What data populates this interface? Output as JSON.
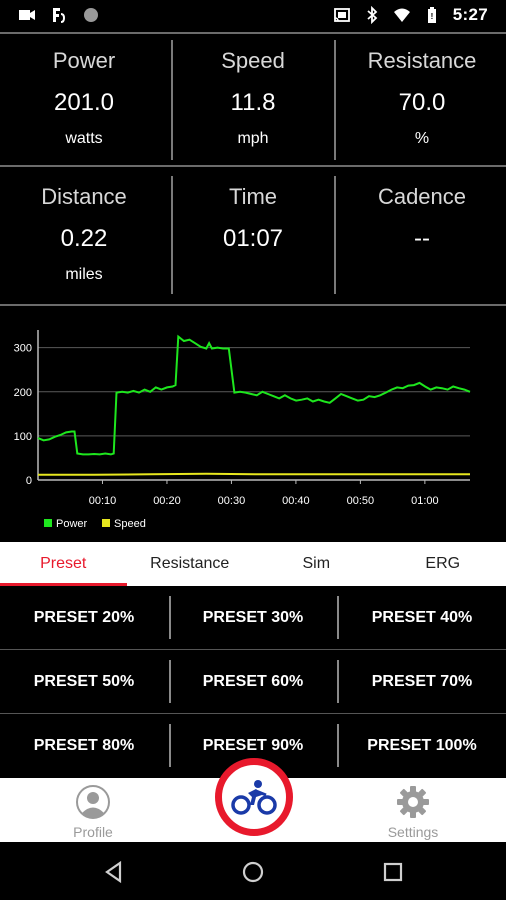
{
  "status_bar": {
    "time": "5:27",
    "left_icons": [
      "video-icon",
      "fire-tv-icon",
      "circle-icon"
    ],
    "right_icons": [
      "cast-icon",
      "bluetooth-icon",
      "wifi-icon",
      "battery-icon"
    ]
  },
  "metrics": [
    {
      "label": "Power",
      "value": "201.0",
      "unit": "watts"
    },
    {
      "label": "Speed",
      "value": "11.8",
      "unit": "mph"
    },
    {
      "label": "Resistance",
      "value": "70.0",
      "unit": "%"
    },
    {
      "label": "Distance",
      "value": "0.22",
      "unit": "miles"
    },
    {
      "label": "Time",
      "value": "01:07",
      "unit": ""
    },
    {
      "label": "Cadence",
      "value": "--",
      "unit": ""
    }
  ],
  "chart_data": {
    "type": "line",
    "x_tick_labels": [
      "00:10",
      "00:20",
      "00:30",
      "00:40",
      "00:50",
      "01:00"
    ],
    "y_tick_labels": [
      "0",
      "100",
      "200",
      "300"
    ],
    "ylim": [
      0,
      340
    ],
    "xlim": [
      0,
      68
    ],
    "grid": true,
    "legend_position": "bottom-left",
    "series": [
      {
        "name": "Power",
        "color": "#1ee61e",
        "points": [
          [
            0,
            95
          ],
          [
            1,
            90
          ],
          [
            2,
            92
          ],
          [
            3,
            98
          ],
          [
            4,
            102
          ],
          [
            5,
            108
          ],
          [
            6,
            110
          ],
          [
            6.5,
            110
          ],
          [
            7,
            60
          ],
          [
            8,
            58
          ],
          [
            9,
            58
          ],
          [
            10,
            59
          ],
          [
            11,
            58
          ],
          [
            12,
            60
          ],
          [
            13,
            58
          ],
          [
            13.5,
            60
          ],
          [
            14,
            198
          ],
          [
            15,
            200
          ],
          [
            16,
            198
          ],
          [
            17,
            202
          ],
          [
            18,
            198
          ],
          [
            19,
            205
          ],
          [
            20,
            200
          ],
          [
            21,
            210
          ],
          [
            22,
            205
          ],
          [
            23,
            210
          ],
          [
            24,
            212
          ],
          [
            24.5,
            215
          ],
          [
            25,
            325
          ],
          [
            26,
            315
          ],
          [
            27,
            318
          ],
          [
            28,
            310
          ],
          [
            29,
            302
          ],
          [
            30,
            298
          ],
          [
            30.5,
            310
          ],
          [
            31,
            298
          ],
          [
            32,
            300
          ],
          [
            33,
            298
          ],
          [
            34,
            298
          ],
          [
            35,
            198
          ],
          [
            36,
            200
          ],
          [
            37,
            198
          ],
          [
            38,
            195
          ],
          [
            39,
            192
          ],
          [
            40,
            200
          ],
          [
            41,
            195
          ],
          [
            42,
            190
          ],
          [
            43,
            185
          ],
          [
            44,
            192
          ],
          [
            45,
            185
          ],
          [
            46,
            180
          ],
          [
            47,
            182
          ],
          [
            48,
            185
          ],
          [
            49,
            178
          ],
          [
            50,
            182
          ],
          [
            51,
            178
          ],
          [
            52,
            175
          ],
          [
            53,
            185
          ],
          [
            54,
            195
          ],
          [
            55,
            190
          ],
          [
            56,
            185
          ],
          [
            57,
            180
          ],
          [
            58,
            182
          ],
          [
            59,
            190
          ],
          [
            60,
            188
          ],
          [
            61,
            192
          ],
          [
            62,
            198
          ],
          [
            63,
            205
          ],
          [
            64,
            210
          ],
          [
            65,
            208
          ],
          [
            66,
            214
          ],
          [
            67,
            215
          ],
          [
            68,
            220
          ],
          [
            69,
            212
          ],
          [
            70,
            205
          ],
          [
            71,
            210
          ],
          [
            72,
            208
          ],
          [
            73,
            205
          ],
          [
            74,
            212
          ],
          [
            75,
            208
          ],
          [
            76,
            205
          ],
          [
            77,
            200
          ]
        ]
      },
      {
        "name": "Speed",
        "color": "#e6e61e",
        "points": [
          [
            0,
            12
          ],
          [
            10,
            12
          ],
          [
            20,
            13
          ],
          [
            30,
            14
          ],
          [
            40,
            13
          ],
          [
            50,
            13
          ],
          [
            60,
            13
          ],
          [
            70,
            13
          ],
          [
            77,
            13
          ]
        ]
      }
    ]
  },
  "tabs": [
    {
      "label": "Preset",
      "active": true
    },
    {
      "label": "Resistance",
      "active": false
    },
    {
      "label": "Sim",
      "active": false
    },
    {
      "label": "ERG",
      "active": false
    }
  ],
  "presets": [
    "PRESET 20%",
    "PRESET 30%",
    "PRESET 40%",
    "PRESET 50%",
    "PRESET 60%",
    "PRESET 70%",
    "PRESET 80%",
    "PRESET 90%",
    "PRESET 100%"
  ],
  "bottom_nav": {
    "profile_label": "Profile",
    "settings_label": "Settings",
    "center_icon": "cyclist-icon"
  },
  "colors": {
    "accent": "#e8192c",
    "power_line": "#1ee61e",
    "speed_line": "#e6e61e",
    "center_icon": "#1a3aa8"
  }
}
